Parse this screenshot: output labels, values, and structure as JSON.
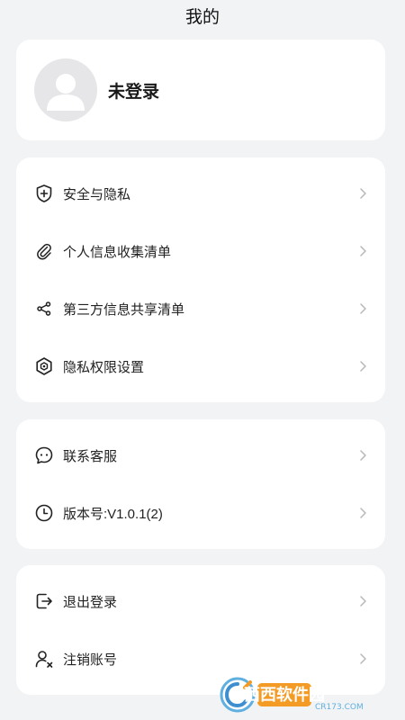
{
  "header": {
    "title": "我的"
  },
  "profile": {
    "name": "未登录"
  },
  "privacy_section": {
    "items": [
      {
        "label": "安全与隐私",
        "icon": "shield-plus-icon"
      },
      {
        "label": "个人信息收集清单",
        "icon": "paperclip-icon"
      },
      {
        "label": "第三方信息共享清单",
        "icon": "share-icon"
      },
      {
        "label": "隐私权限设置",
        "icon": "privacy-settings-icon"
      }
    ]
  },
  "support_section": {
    "items": [
      {
        "label": "联系客服",
        "icon": "chat-bubble-icon"
      },
      {
        "label": "版本号:V1.0.1(2)",
        "icon": "clock-icon"
      }
    ]
  },
  "account_section": {
    "items": [
      {
        "label": "退出登录",
        "icon": "logout-icon"
      },
      {
        "label": "注销账号",
        "icon": "user-remove-icon"
      }
    ]
  },
  "watermark": {
    "text": "西西软件园",
    "sub": "CR173.COM"
  }
}
